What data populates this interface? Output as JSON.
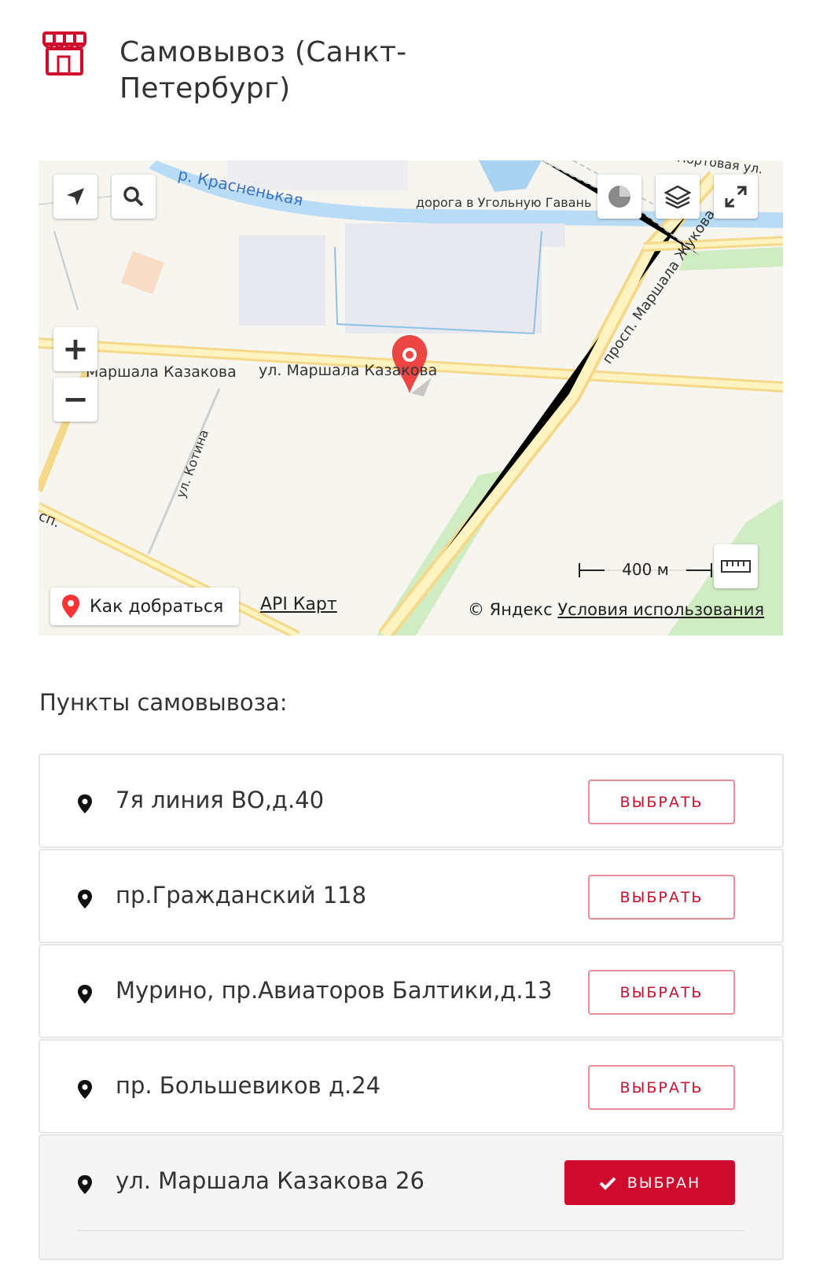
{
  "header": {
    "title": "Самовывоз (Санкт-Петербург)",
    "icon": "store-icon",
    "accent_color": "#cf0a2c"
  },
  "map": {
    "labels": {
      "river": "р. Красненькая",
      "road_top": "дорога в Угольную Гавань",
      "street_top_right": "Портовая ул.",
      "avenue": "просп. Маршала Жукова",
      "street_main_left": "Маршала Казакова",
      "street_main_center": "ул. Маршала Казакова",
      "street_kotina": "ул. Котина",
      "street_left_edge": "сп."
    },
    "scale_label": "400 м",
    "route_button_label": "Как добраться",
    "api_link": "API Карт",
    "copyright": "© Яндекс",
    "terms_link": "Условия использования",
    "controls": {
      "geolocation": "geolocation-icon",
      "search": "search-icon",
      "traffic": "traffic-icon",
      "layers": "layers-icon",
      "fullscreen": "fullscreen-icon",
      "zoom_in": "+",
      "zoom_out": "−",
      "ruler": "ruler-icon"
    }
  },
  "pickup": {
    "section_title": "Пункты самовывоза:",
    "select_label": "ВЫБРАТЬ",
    "selected_label": "ВЫБРАН",
    "points": [
      {
        "address": "7я линия ВО,д.40",
        "selected": false
      },
      {
        "address": "пр.Гражданский 118",
        "selected": false
      },
      {
        "address": "Мурино, пр.Авиаторов Балтики,д.13",
        "selected": false
      },
      {
        "address": "пр. Большевиков д.24",
        "selected": false
      },
      {
        "address": "ул. Маршала Казакова 26",
        "selected": true
      }
    ]
  }
}
